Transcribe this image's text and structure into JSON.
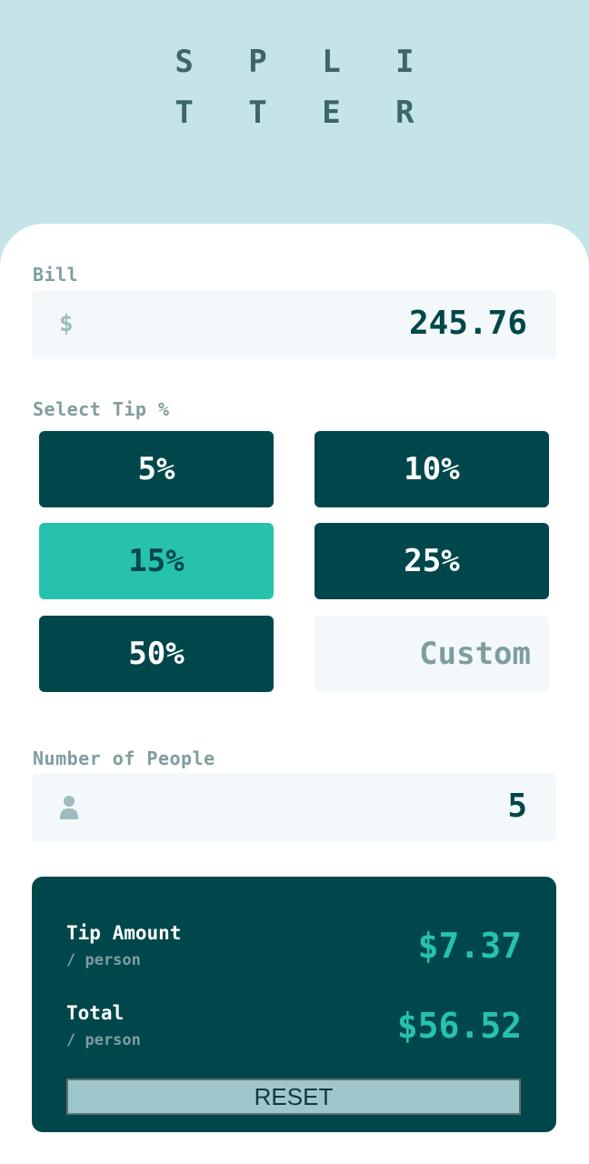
{
  "logo": {
    "line1": "S P L I",
    "line2": "T T E R"
  },
  "bill": {
    "label": "Bill",
    "prefix": "$",
    "value": "245.76"
  },
  "tip": {
    "label": "Select Tip %",
    "options": [
      "5%",
      "10%",
      "15%",
      "25%",
      "50%"
    ],
    "selected": "15%",
    "custom_placeholder": "Custom"
  },
  "people": {
    "label": "Number of People",
    "value": "5",
    "icon": "person-icon"
  },
  "results": {
    "tip_title": "Tip Amount",
    "tip_sub": "/ person",
    "tip_value": "$7.37",
    "total_title": "Total",
    "total_sub": "/ person",
    "total_value": "$56.52",
    "reset_label": "RESET"
  },
  "colors": {
    "background": "#c5e4e7",
    "dark_cyan": "#00474b",
    "strong_cyan": "#26c2ad",
    "input_bg": "#f3f9fa",
    "label_grey": "#7f9d9f"
  }
}
